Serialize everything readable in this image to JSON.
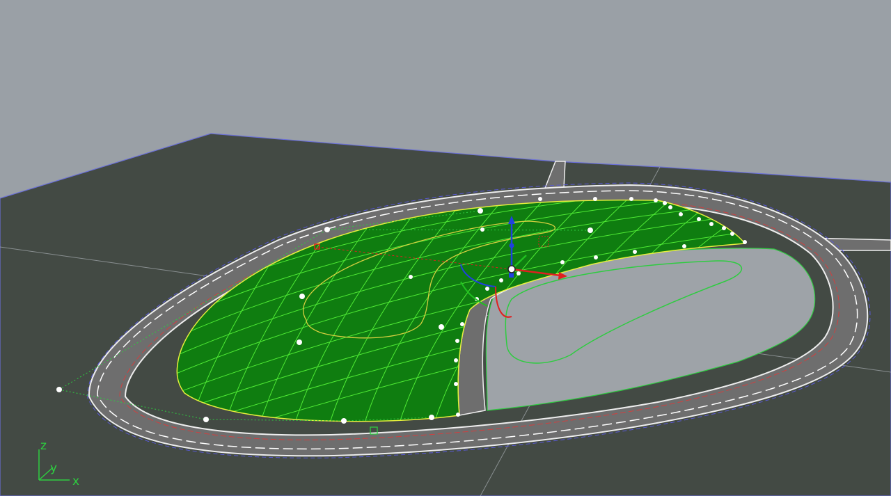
{
  "viewport": {
    "background": "#9aa0a6",
    "ground_color": "#434a44",
    "grid_line_color": "#b8bec4"
  },
  "surface": {
    "fill": "#0f7d10",
    "grid_color": "#5cff3c",
    "boundary_color": "#e6f03c"
  },
  "selection_color": "#2ecc40",
  "road": {
    "color": "#6e6e6e",
    "edge_color": "#eeeeee"
  },
  "axis_indicator": {
    "z": "z",
    "y": "y",
    "x": "x"
  },
  "gizmo": {
    "x_color": "#e02020",
    "y_color": "#20c020",
    "z_color": "#2040e0"
  }
}
